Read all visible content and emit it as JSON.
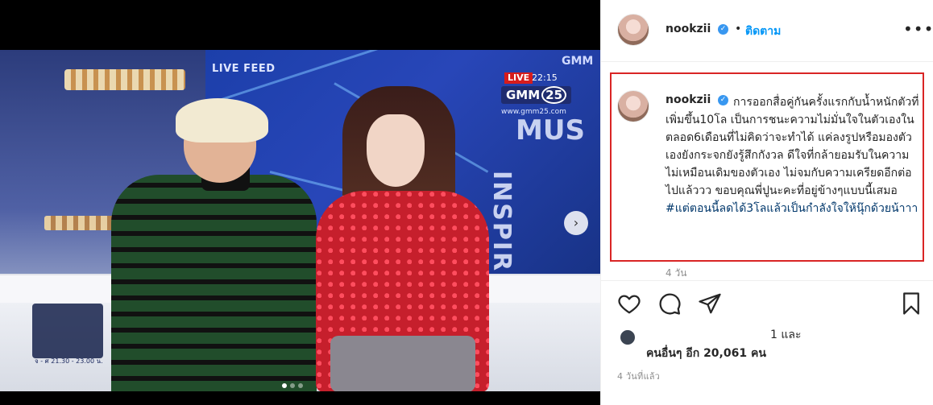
{
  "media": {
    "live_feed": "LIVE FEED",
    "live_badge": "LIVE",
    "live_time": "22:15",
    "channel_logo_text": "GMM",
    "channel_logo_num": "25",
    "channel_url": "www.gmm25.com",
    "channel_top_right": "GMM",
    "backdrop_text_1": "MUS",
    "backdrop_text_2": "INSPIR",
    "show_logo_caption": "จ - ศ 21.30 - 23.00 น.",
    "carousel_next": "›",
    "slides": 3,
    "active_slide": 1
  },
  "header": {
    "username": "nookzii",
    "verified": "✓",
    "bullet": "•",
    "follow_label": "ติดตาม",
    "more": "•••"
  },
  "caption": {
    "username": "nookzii",
    "text_before_hashtag": "การออกสื่อคู่กันครั้งแรกกับน้ำหนักตัวที่เพิ่มขึ้น10โล เป็นการชนะความไม่มั่นใจในตัวเองในตลอด6เดือนที่ไม่คิดว่าจะทำได้ แค่ลงรูปหรือมองตัวเองยังกระจกยังรู้สึกกังวล ดีใจที่กล้ายอมรับในความไม่เหมือนเดิมของตัวเอง ไม่จมกับความเครียดอีกต่อไปแล้ววว ขอบคุณพี่ปูนะคะที่อยู่ข้างๆแบบนี้เสมอ ",
    "hashtag": "#แต่ตอนนี้ลดได้3โลแล้วเป็นกำลังใจให้นุ๊กด้วยน้าาา",
    "age": "4 วัน"
  },
  "likes": {
    "line1": "1 และ",
    "line2": "คนอื่นๆ อีก 20,061 คน"
  },
  "post_time": "4 วันที่แล้ว",
  "colors": {
    "follow": "#0095f6",
    "highlight_box": "#d92525",
    "hashtag": "#00376b",
    "verified": "#3897f0"
  }
}
